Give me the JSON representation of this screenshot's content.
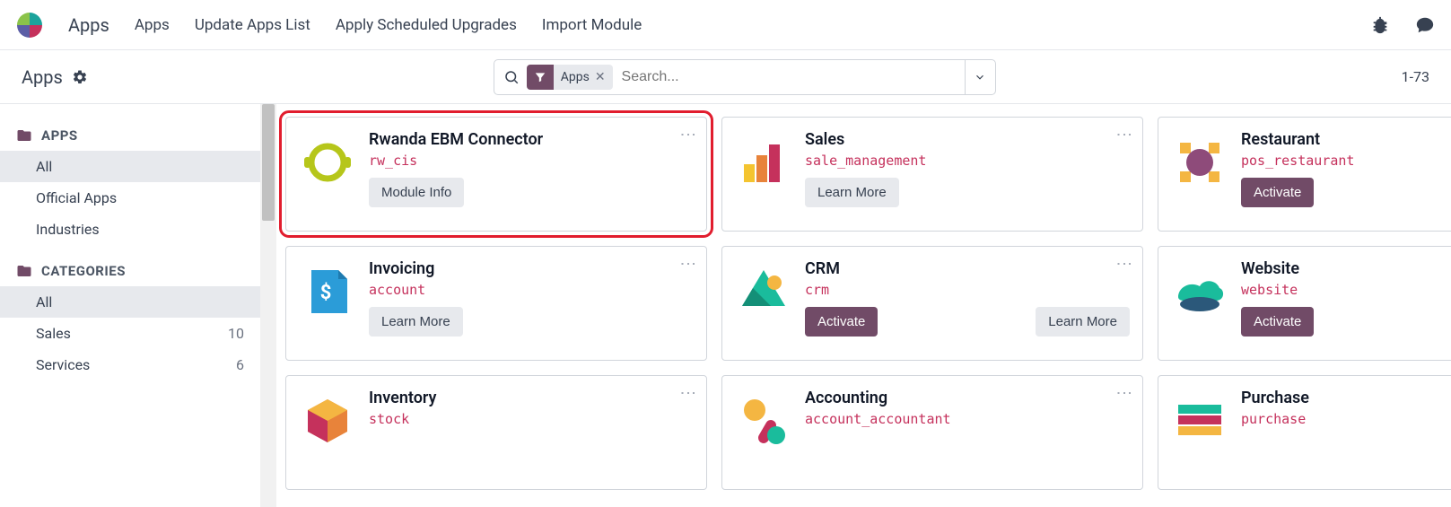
{
  "topbar": {
    "brand": "Apps",
    "nav": [
      "Apps",
      "Update Apps List",
      "Apply Scheduled Upgrades",
      "Import Module"
    ]
  },
  "subbar": {
    "title": "Apps",
    "search_placeholder": "Search...",
    "filter_label": "Apps",
    "pager": "1-73"
  },
  "sidebar": {
    "sections": [
      {
        "title": "APPS",
        "items": [
          {
            "label": "All",
            "active": true
          },
          {
            "label": "Official Apps"
          },
          {
            "label": "Industries"
          }
        ]
      },
      {
        "title": "CATEGORIES",
        "items": [
          {
            "label": "All",
            "active": true
          },
          {
            "label": "Sales",
            "count": 10
          },
          {
            "label": "Services",
            "count": 6
          }
        ]
      }
    ]
  },
  "cards": [
    {
      "name": "Rwanda EBM Connector",
      "tech": "rw_cis",
      "buttons": [
        {
          "label": "Module Info",
          "style": "default"
        }
      ],
      "icon": "rwcis",
      "highlight": true
    },
    {
      "name": "Sales",
      "tech": "sale_management",
      "buttons": [
        {
          "label": "Learn More",
          "style": "default"
        }
      ],
      "icon": "sales"
    },
    {
      "name": "Restaurant",
      "tech": "pos_restaurant",
      "buttons": [
        {
          "label": "Activate",
          "style": "primary"
        }
      ],
      "icon": "restaurant"
    },
    {
      "name": "Invoicing",
      "tech": "account",
      "buttons": [
        {
          "label": "Learn More",
          "style": "default"
        }
      ],
      "icon": "invoicing"
    },
    {
      "name": "CRM",
      "tech": "crm",
      "buttons": [
        {
          "label": "Activate",
          "style": "primary"
        },
        {
          "label": "Learn More",
          "style": "default",
          "right": true
        }
      ],
      "icon": "crm"
    },
    {
      "name": "Website",
      "tech": "website",
      "buttons": [
        {
          "label": "Activate",
          "style": "primary"
        }
      ],
      "icon": "website"
    },
    {
      "name": "Inventory",
      "tech": "stock",
      "buttons": [],
      "icon": "inventory"
    },
    {
      "name": "Accounting",
      "tech": "account_accountant",
      "buttons": [],
      "icon": "accounting"
    },
    {
      "name": "Purchase",
      "tech": "purchase",
      "buttons": [],
      "icon": "purchase"
    }
  ]
}
